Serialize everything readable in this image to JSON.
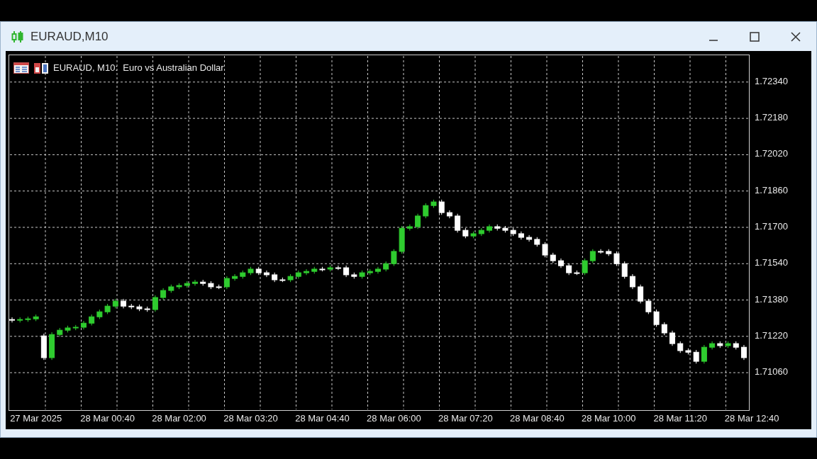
{
  "window": {
    "title": "EURAUD,M10"
  },
  "chart": {
    "legend": "EURAUD, M10:  Euro vs Australian Dollar",
    "chart_data": {
      "type": "candlestick",
      "grid": true,
      "ylim": [
        1.70895,
        1.72458
      ],
      "categories": [
        null,
        null,
        null,
        "27 Mar 2025",
        null,
        null,
        null,
        null,
        null,
        null,
        null,
        null,
        "28 Mar 00:40",
        null,
        null,
        null,
        null,
        null,
        null,
        null,
        null,
        "28 Mar 02:00",
        null,
        null,
        null,
        null,
        null,
        null,
        null,
        null,
        "28 Mar 03:20",
        null,
        null,
        null,
        null,
        null,
        null,
        null,
        null,
        "28 Mar 04:40",
        null,
        null,
        null,
        null,
        null,
        null,
        null,
        null,
        "28 Mar 06:00",
        null,
        null,
        null,
        null,
        null,
        null,
        null,
        null,
        "28 Mar 07:20",
        null,
        null,
        null,
        null,
        null,
        null,
        null,
        null,
        "28 Mar 08:40",
        null,
        null,
        null,
        null,
        null,
        null,
        null,
        null,
        "28 Mar 10:00",
        null,
        null,
        null,
        null,
        null,
        null,
        null,
        null,
        "28 Mar 11:20",
        null,
        null,
        null,
        null,
        null,
        null,
        null,
        null,
        "28 Mar 12:40"
      ],
      "yticks": [
        {
          "value": 1.7234,
          "label": "1.72340"
        },
        {
          "value": 1.7218,
          "label": "1.72180"
        },
        {
          "value": 1.7202,
          "label": "1.72020"
        },
        {
          "value": 1.7186,
          "label": "1.71860"
        },
        {
          "value": 1.717,
          "label": "1.71700"
        },
        {
          "value": 1.7154,
          "label": "1.71540"
        },
        {
          "value": 1.7138,
          "label": "1.71380"
        },
        {
          "value": 1.7122,
          "label": "1.71220"
        },
        {
          "value": 1.7106,
          "label": "1.71060"
        }
      ],
      "ohlc": [
        [
          1.71294,
          1.71304,
          1.71281,
          1.71291
        ],
        [
          1.71291,
          1.71304,
          1.71281,
          1.71294
        ],
        [
          1.71294,
          1.71307,
          1.71284,
          1.71297
        ],
        [
          1.71297,
          1.71316,
          1.71287,
          1.71306
        ],
        [
          1.71222,
          1.71232,
          1.71116,
          1.71126
        ],
        [
          1.71126,
          1.71238,
          1.71116,
          1.71228
        ],
        [
          1.71228,
          1.71257,
          1.71218,
          1.71247
        ],
        [
          1.71247,
          1.71267,
          1.71237,
          1.71257
        ],
        [
          1.71257,
          1.7127,
          1.71247,
          1.7126
        ],
        [
          1.7126,
          1.71288,
          1.7125,
          1.71278
        ],
        [
          1.71278,
          1.71316,
          1.71268,
          1.71306
        ],
        [
          1.71306,
          1.71338,
          1.71296,
          1.71328
        ],
        [
          1.71328,
          1.71363,
          1.71318,
          1.71353
        ],
        [
          1.71353,
          1.71385,
          1.71343,
          1.71375
        ],
        [
          1.71375,
          1.71385,
          1.71343,
          1.71353
        ],
        [
          1.71353,
          1.71363,
          1.7134,
          1.7135
        ],
        [
          1.7135,
          1.7136,
          1.71331,
          1.71341
        ],
        [
          1.71341,
          1.71351,
          1.71328,
          1.71338
        ],
        [
          1.71338,
          1.71401,
          1.71328,
          1.71391
        ],
        [
          1.71391,
          1.71432,
          1.71381,
          1.71422
        ],
        [
          1.71422,
          1.71448,
          1.71412,
          1.71438
        ],
        [
          1.71438,
          1.71454,
          1.71428,
          1.71444
        ],
        [
          1.71444,
          1.71463,
          1.71434,
          1.71453
        ],
        [
          1.71453,
          1.71469,
          1.71443,
          1.71459
        ],
        [
          1.71459,
          1.71469,
          1.71443,
          1.71453
        ],
        [
          1.71453,
          1.71463,
          1.71428,
          1.71438
        ],
        [
          1.71438,
          1.71448,
          1.71428,
          1.71438
        ],
        [
          1.71438,
          1.71485,
          1.71428,
          1.71475
        ],
        [
          1.71475,
          1.71494,
          1.71465,
          1.71484
        ],
        [
          1.71484,
          1.7151,
          1.71474,
          1.715
        ],
        [
          1.715,
          1.71526,
          1.7149,
          1.71516
        ],
        [
          1.71516,
          1.71526,
          1.7149,
          1.715
        ],
        [
          1.715,
          1.7151,
          1.71481,
          1.71491
        ],
        [
          1.71491,
          1.71501,
          1.71459,
          1.71469
        ],
        [
          1.71469,
          1.71479,
          1.71459,
          1.71469
        ],
        [
          1.71469,
          1.71494,
          1.71459,
          1.71484
        ],
        [
          1.71484,
          1.7151,
          1.71474,
          1.715
        ],
        [
          1.715,
          1.71516,
          1.7149,
          1.71506
        ],
        [
          1.71506,
          1.71526,
          1.71496,
          1.71516
        ],
        [
          1.71516,
          1.71526,
          1.71506,
          1.71516
        ],
        [
          1.71516,
          1.71532,
          1.71506,
          1.71522
        ],
        [
          1.71522,
          1.71532,
          1.71512,
          1.71522
        ],
        [
          1.71522,
          1.71532,
          1.71481,
          1.71491
        ],
        [
          1.71491,
          1.71501,
          1.71474,
          1.71484
        ],
        [
          1.71484,
          1.7151,
          1.71474,
          1.715
        ],
        [
          1.715,
          1.71516,
          1.7149,
          1.71506
        ],
        [
          1.71506,
          1.71526,
          1.71496,
          1.71516
        ],
        [
          1.71516,
          1.7155,
          1.71506,
          1.7154
        ],
        [
          1.7154,
          1.71604,
          1.7153,
          1.71594
        ],
        [
          1.71594,
          1.71706,
          1.71584,
          1.71696
        ],
        [
          1.71696,
          1.71713,
          1.71686,
          1.71703
        ],
        [
          1.71703,
          1.7176,
          1.71693,
          1.7175
        ],
        [
          1.7175,
          1.71806,
          1.7174,
          1.71796
        ],
        [
          1.71796,
          1.71822,
          1.71786,
          1.71812
        ],
        [
          1.71812,
          1.71822,
          1.71755,
          1.71765
        ],
        [
          1.71765,
          1.71775,
          1.7174,
          1.7175
        ],
        [
          1.7175,
          1.7176,
          1.71677,
          1.71687
        ],
        [
          1.71687,
          1.71697,
          1.71652,
          1.71662
        ],
        [
          1.71662,
          1.71682,
          1.71652,
          1.71672
        ],
        [
          1.71672,
          1.71697,
          1.71662,
          1.71687
        ],
        [
          1.71687,
          1.71713,
          1.71677,
          1.71703
        ],
        [
          1.71703,
          1.71713,
          1.71686,
          1.71696
        ],
        [
          1.71696,
          1.71706,
          1.71677,
          1.71687
        ],
        [
          1.71687,
          1.71697,
          1.71662,
          1.71672
        ],
        [
          1.71672,
          1.71682,
          1.71646,
          1.71656
        ],
        [
          1.71656,
          1.71666,
          1.71637,
          1.71647
        ],
        [
          1.71647,
          1.71657,
          1.71615,
          1.71625
        ],
        [
          1.71625,
          1.71635,
          1.71568,
          1.71578
        ],
        [
          1.71578,
          1.71588,
          1.71543,
          1.71553
        ],
        [
          1.71553,
          1.71563,
          1.71521,
          1.71531
        ],
        [
          1.71531,
          1.71541,
          1.7149,
          1.715
        ],
        [
          1.715,
          1.7151,
          1.7149,
          1.715
        ],
        [
          1.715,
          1.71563,
          1.7149,
          1.71553
        ],
        [
          1.71553,
          1.71604,
          1.71543,
          1.71594
        ],
        [
          1.71594,
          1.71604,
          1.71584,
          1.71594
        ],
        [
          1.71594,
          1.71604,
          1.71574,
          1.71584
        ],
        [
          1.71584,
          1.71594,
          1.7153,
          1.7154
        ],
        [
          1.7154,
          1.7155,
          1.71474,
          1.71484
        ],
        [
          1.71484,
          1.71494,
          1.71428,
          1.71438
        ],
        [
          1.71438,
          1.71448,
          1.71365,
          1.71375
        ],
        [
          1.71375,
          1.71385,
          1.71318,
          1.71328
        ],
        [
          1.71328,
          1.71338,
          1.71262,
          1.71272
        ],
        [
          1.71272,
          1.71282,
          1.71225,
          1.71235
        ],
        [
          1.71235,
          1.71245,
          1.71178,
          1.71188
        ],
        [
          1.71188,
          1.71198,
          1.71147,
          1.71157
        ],
        [
          1.71157,
          1.71167,
          1.7114,
          1.7115
        ],
        [
          1.7115,
          1.7116,
          1.711,
          1.7111
        ],
        [
          1.7111,
          1.71182,
          1.711,
          1.71172
        ],
        [
          1.71172,
          1.71198,
          1.71162,
          1.71188
        ],
        [
          1.71188,
          1.71198,
          1.71169,
          1.71179
        ],
        [
          1.71179,
          1.71198,
          1.71169,
          1.71188
        ],
        [
          1.71188,
          1.71198,
          1.71162,
          1.71172
        ],
        [
          1.71172,
          1.71182,
          1.71116,
          1.71126
        ],
        null
      ]
    }
  }
}
